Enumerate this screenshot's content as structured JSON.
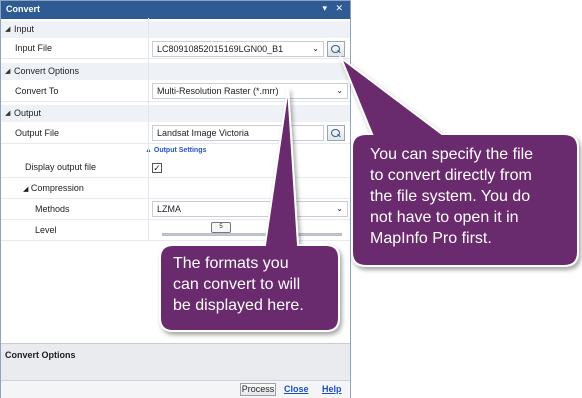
{
  "window": {
    "title": "Convert",
    "buttons": "▾ ✕"
  },
  "sections": {
    "input": "Input",
    "convert_options": "Convert Options",
    "output": "Output"
  },
  "rows": {
    "input_file_label": "Input File",
    "input_file_value": "LC80910852015169LGN00_B1",
    "convert_to_label": "Convert To",
    "convert_to_value": "Multi-Resolution Raster (*.mrr)",
    "output_file_label": "Output File",
    "output_file_value": "Landsat Image Victoria",
    "output_settings": "Output Settings",
    "display_output_label": "Display output file",
    "display_output_checked": "✓",
    "compression_label": "Compression",
    "methods_label": "Methods",
    "methods_value": "LZMA",
    "level_label": "Level",
    "level_value": "5"
  },
  "bottom": {
    "section_label": "Convert Options"
  },
  "footer": {
    "process": "Process",
    "close": "Close",
    "help": "Help"
  },
  "callouts": {
    "right": [
      "You can specify the file",
      "to convert directly from",
      "the file system. You do",
      "not have to open it in",
      "MapInfo Pro first."
    ],
    "middle": [
      "The formats you",
      "can convert to will",
      "be displayed here."
    ]
  },
  "colors": {
    "title_bar": "#2f5b94",
    "callout_fill": "#6b2a6e",
    "link": "#1a4fc4"
  }
}
